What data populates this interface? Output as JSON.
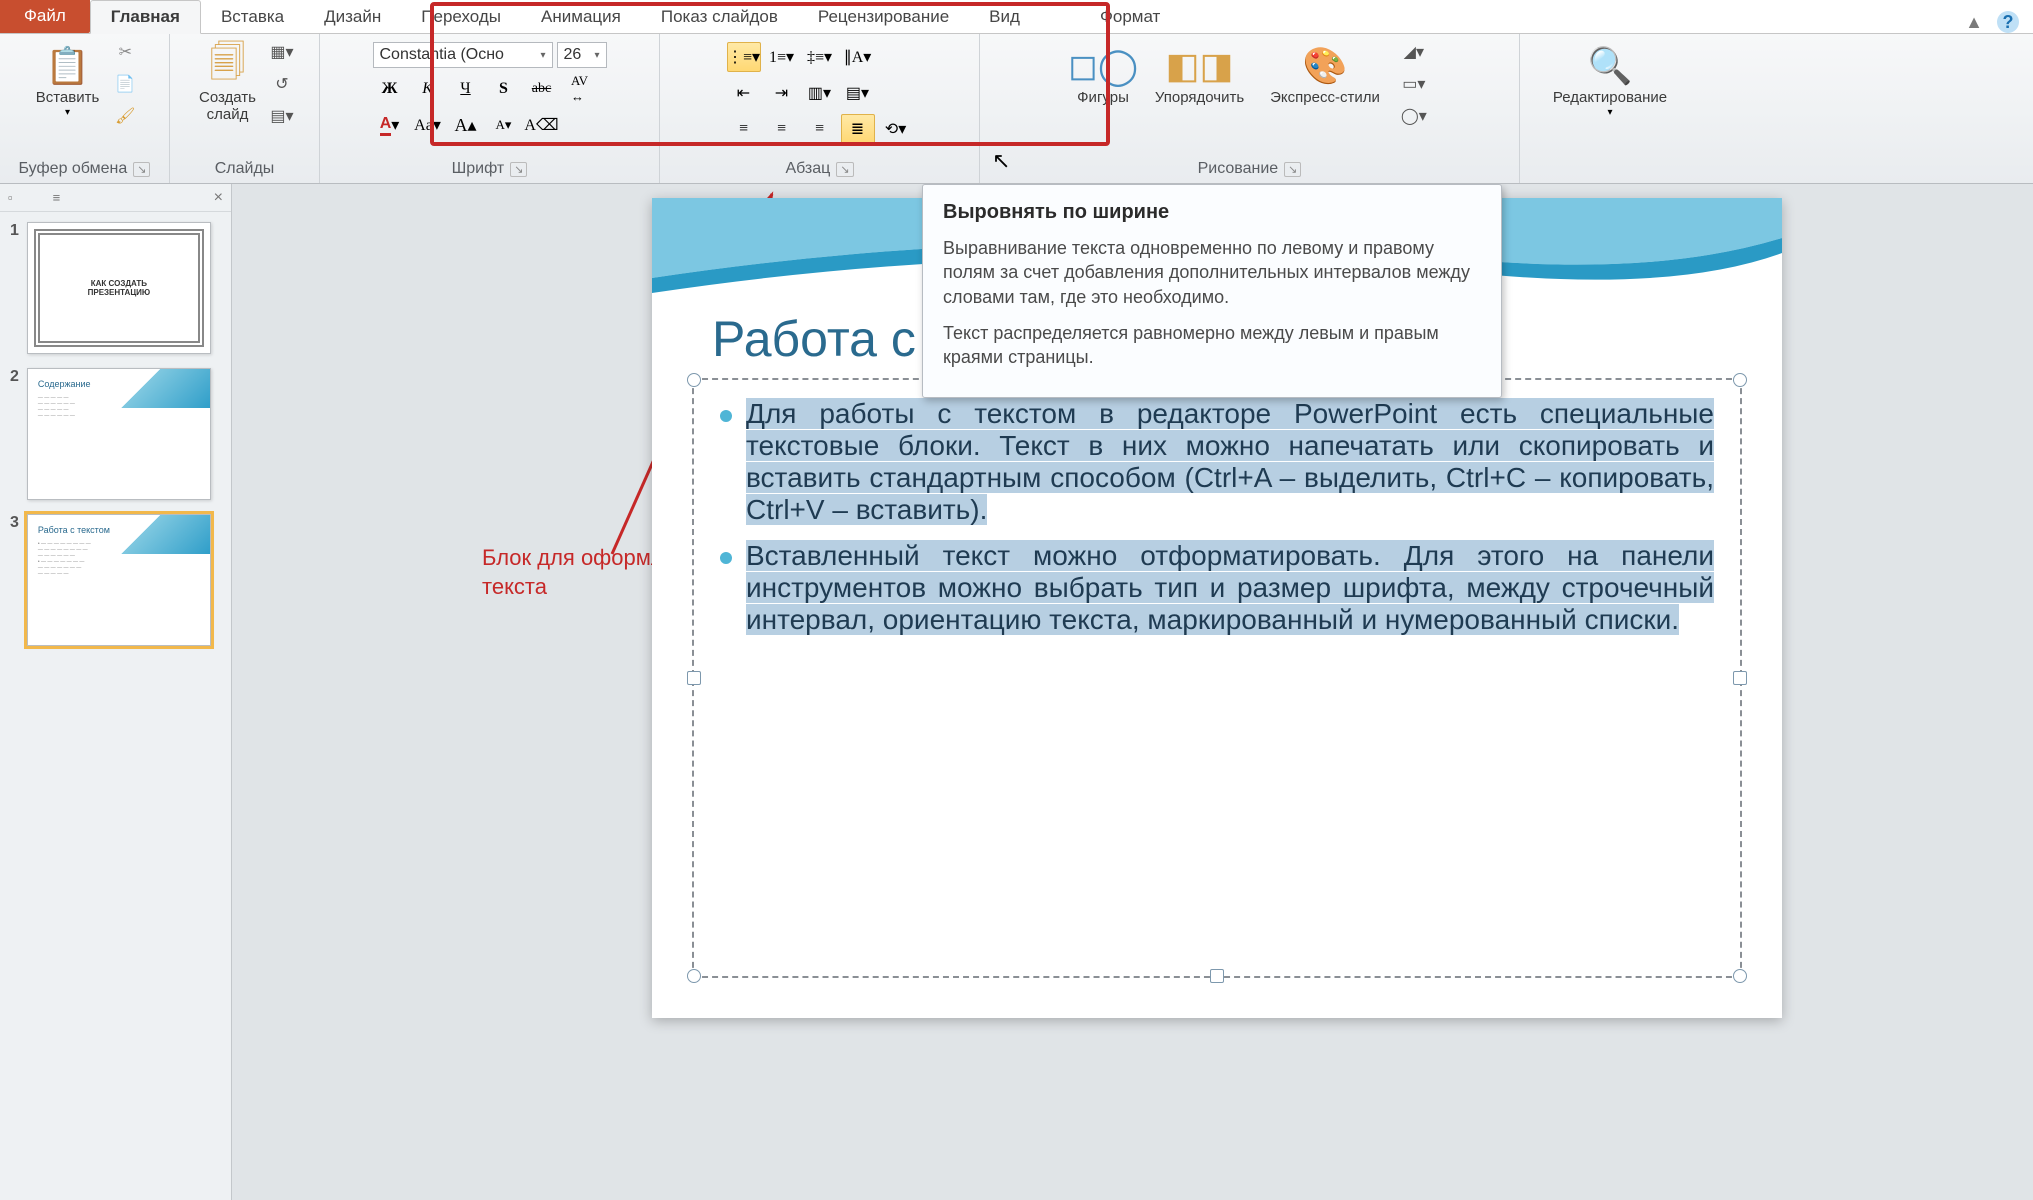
{
  "tabs": {
    "file": "Файл",
    "home": "Главная",
    "insert": "Вставка",
    "design": "Дизайн",
    "transitions": "Переходы",
    "animation": "Анимация",
    "slideshow": "Показ слайдов",
    "review": "Рецензирование",
    "view": "Вид",
    "format": "Формат"
  },
  "groups": {
    "clipboard": "Буфер обмена",
    "slides": "Слайды",
    "font": "Шрифт",
    "paragraph": "Абзац",
    "drawing": "Рисование",
    "editing": "Редактирование"
  },
  "buttons": {
    "paste": "Вставить",
    "new_slide": "Создать\nслайд",
    "shapes": "Фигуры",
    "arrange": "Упорядочить",
    "quick_styles": "Экспресс-стили",
    "editing": "Редактирование"
  },
  "font": {
    "name": "Constantia (Осно",
    "size": "26"
  },
  "tooltip": {
    "title": "Выровнять по ширине",
    "p1": "Выравнивание текста одновременно по левому и правому полям за счет добавления дополнительных интервалов между словами там, где это необходимо.",
    "p2": "Текст распределяется равномерно между левым и правым краями страницы."
  },
  "annotation": "Блок для оформления\nтекста",
  "slide": {
    "title": "Работа с текстом",
    "bullet1": "Для работы с текстом в редакторе PowerPoint есть специальные текстовые блоки. Текст в них можно напечатать или скопировать и вставить стандартным способом (Ctrl+A – выделить, Ctrl+C – копировать, Ctrl+V – вставить).",
    "bullet2": "Вставленный текст можно отформатировать. Для этого на панели инструментов можно выбрать тип и размер шрифта, между строчечный интервал, ориентацию текста, маркированный и нумерованный списки."
  },
  "thumbs": {
    "t1_l1": "КАК СОЗДАТЬ",
    "t1_l2": "ПРЕЗЕНТАЦИЮ",
    "t2_title": "Содержание",
    "t3_title": "Работа с текстом"
  }
}
